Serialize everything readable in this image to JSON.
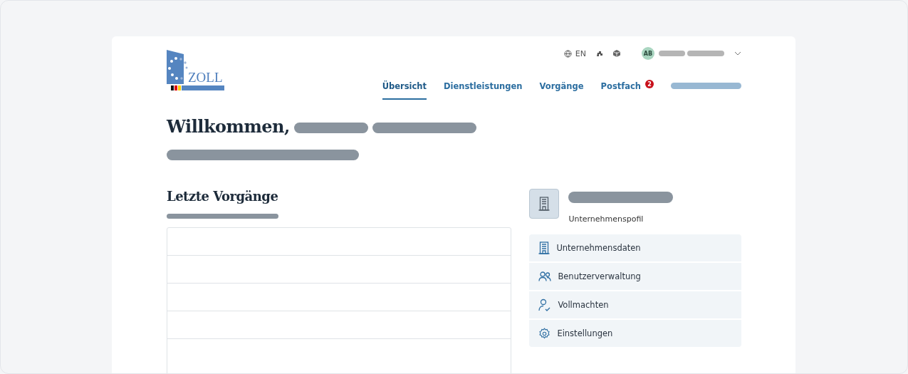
{
  "header": {
    "logo_text": "ZOLL",
    "language": "EN",
    "avatar": "AB",
    "nav": [
      {
        "label": "Übersicht",
        "selected": true
      },
      {
        "label": "Dienstleistungen",
        "selected": false
      },
      {
        "label": "Vorgänge",
        "selected": false
      },
      {
        "label": "Postfach",
        "selected": false,
        "badge": "2"
      }
    ]
  },
  "welcome": {
    "title": "Willkommen,"
  },
  "recent": {
    "title": "Letzte Vorgänge"
  },
  "profile": {
    "caption": "Unternehmenspofil",
    "menu": [
      {
        "label": "Unternehmensdaten",
        "kind": "building"
      },
      {
        "label": "Benutzerverwaltung",
        "kind": "users"
      },
      {
        "label": "Vollmachten",
        "kind": "user-check"
      },
      {
        "label": "Einstellungen",
        "kind": "gear"
      }
    ]
  }
}
